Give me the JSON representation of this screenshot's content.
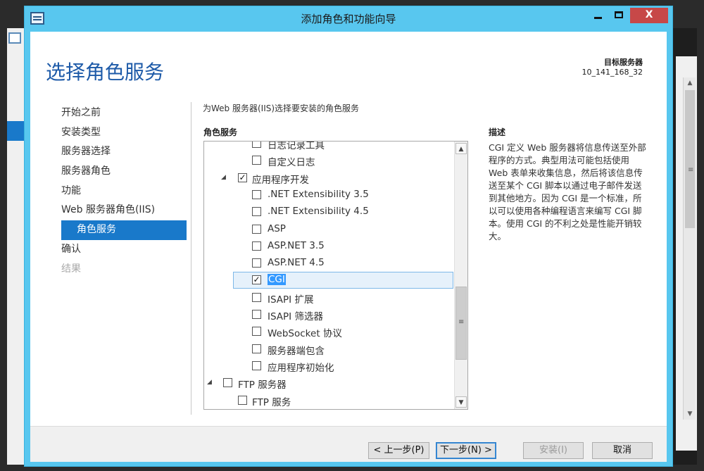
{
  "window": {
    "title": "添加角色和功能向导",
    "min_label": "",
    "close_label": "X"
  },
  "page": {
    "heading": "选择角色服务",
    "target_label": "目标服务器",
    "target_value": "10_141_168_32",
    "instruction": "为Web 服务器(IIS)选择要安装的角色服务",
    "role_services_label": "角色服务",
    "description_label": "描述",
    "description_text": "CGI 定义 Web 服务器将信息传送至外部程序的方式。典型用法可能包括使用 Web 表单来收集信息，然后将该信息传送至某个 CGI 脚本以通过电子邮件发送到其他地方。因为 CGI 是一个标准，所以可以使用各种编程语言来编写 CGI 脚本。使用 CGI 的不利之处是性能开销较大。"
  },
  "nav": {
    "items": [
      {
        "label": "开始之前",
        "state": "normal"
      },
      {
        "label": "安装类型",
        "state": "normal"
      },
      {
        "label": "服务器选择",
        "state": "normal"
      },
      {
        "label": "服务器角色",
        "state": "normal"
      },
      {
        "label": "功能",
        "state": "normal"
      },
      {
        "label": "Web 服务器角色(IIS)",
        "state": "normal"
      },
      {
        "label": "角色服务",
        "state": "active"
      },
      {
        "label": "确认",
        "state": "normal"
      },
      {
        "label": "结果",
        "state": "disabled"
      }
    ]
  },
  "tree": {
    "items": [
      {
        "label": "日志记录工具",
        "checked": false,
        "level": 2
      },
      {
        "label": "自定义日志",
        "checked": false,
        "level": 2
      },
      {
        "label": "应用程序开发",
        "checked": true,
        "level": 1,
        "expanded": true
      },
      {
        "label": ".NET Extensibility 3.5",
        "checked": false,
        "level": 2
      },
      {
        "label": ".NET Extensibility 4.5",
        "checked": false,
        "level": 2
      },
      {
        "label": "ASP",
        "checked": false,
        "level": 2
      },
      {
        "label": "ASP.NET 3.5",
        "checked": false,
        "level": 2
      },
      {
        "label": "ASP.NET 4.5",
        "checked": false,
        "level": 2
      },
      {
        "label": "CGI",
        "checked": true,
        "level": 2,
        "selected": true
      },
      {
        "label": "ISAPI 扩展",
        "checked": false,
        "level": 2
      },
      {
        "label": "ISAPI 筛选器",
        "checked": false,
        "level": 2
      },
      {
        "label": "WebSocket 协议",
        "checked": false,
        "level": 2
      },
      {
        "label": "服务器端包含",
        "checked": false,
        "level": 2
      },
      {
        "label": "应用程序初始化",
        "checked": false,
        "level": 2
      },
      {
        "label": "FTP 服务器",
        "checked": false,
        "level": 0,
        "expanded": true
      },
      {
        "label": "FTP 服务",
        "checked": false,
        "level": 1
      }
    ]
  },
  "footer": {
    "prev_label": "< 上一步(P)",
    "next_label": "下一步(N) >",
    "install_label": "安装(I)",
    "cancel_label": "取消"
  },
  "icons": {
    "expanded_glyph": "◢",
    "check_glyph": "✓",
    "scroll_up_glyph": "▲",
    "scroll_down_glyph": "▼",
    "grip_glyph": "≡"
  }
}
